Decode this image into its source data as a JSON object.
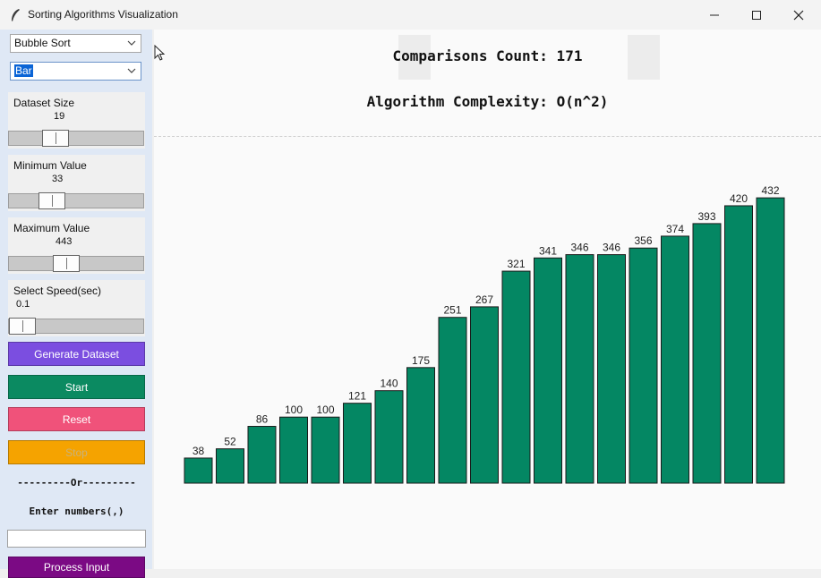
{
  "window": {
    "title": "Sorting Algorithms Visualization",
    "icon": "feather-icon"
  },
  "sidebar": {
    "algorithm_select": {
      "value": "Bubble Sort"
    },
    "chart_type_select": {
      "value": "Bar"
    },
    "dataset_size": {
      "label": "Dataset Size",
      "value": "19",
      "level": 0.3
    },
    "min_value": {
      "label": "Minimum Value",
      "value": "33",
      "level": 0.27
    },
    "max_value": {
      "label": "Maximum Value",
      "value": "443",
      "level": 0.4
    },
    "speed": {
      "label": "Select Speed(sec)",
      "value": "0.1",
      "level": 0.0
    },
    "buttons": {
      "generate": "Generate Dataset",
      "start": "Start",
      "reset": "Reset",
      "stop": "Stop",
      "process": "Process Input"
    },
    "or_divider": "---------Or---------",
    "enter_label": "Enter numbers(,)",
    "numbers_input": {
      "value": ""
    },
    "colors": {
      "generate": "#7b4ee0",
      "start": "#0b8a61",
      "reset": "#f0527a",
      "stop": "#f5a300",
      "process": "#7b0a84"
    }
  },
  "main": {
    "comparisons": "Comparisons Count: 171",
    "complexity": "Algorithm Complexity: O(n^2)"
  },
  "chart_data": {
    "type": "bar",
    "values": [
      38,
      52,
      86,
      100,
      100,
      121,
      140,
      175,
      251,
      267,
      321,
      341,
      346,
      346,
      356,
      374,
      393,
      420,
      432
    ],
    "bar_color": "#048763",
    "ylim": [
      0,
      443
    ]
  }
}
